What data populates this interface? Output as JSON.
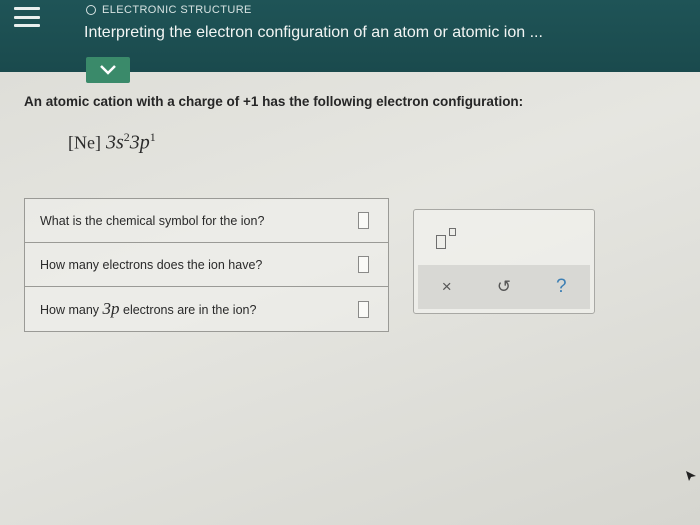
{
  "header": {
    "section": "ELECTRONIC STRUCTURE",
    "title": "Interpreting the electron configuration of an atom or atomic ion ..."
  },
  "problem": {
    "prompt": "An atomic cation with a charge of +1 has the following electron configuration:",
    "config": {
      "core": "[Ne]",
      "orbital1": "3s",
      "exp1": "2",
      "orbital2": "3p",
      "exp2": "1"
    }
  },
  "questions": [
    {
      "text": "What is the chemical symbol for the ion?"
    },
    {
      "text": "How many electrons does the ion have?"
    },
    {
      "prefix": "How many ",
      "highlight": "3p",
      "suffix": " electrons are in the ion?"
    }
  ],
  "palette": {
    "clear_glyph": "×",
    "undo_glyph": "↺",
    "help_glyph": "?"
  },
  "colors": {
    "header_bg": "#1f5457",
    "accent_green": "#3a8a6a",
    "help_blue": "#3d7fb4"
  }
}
